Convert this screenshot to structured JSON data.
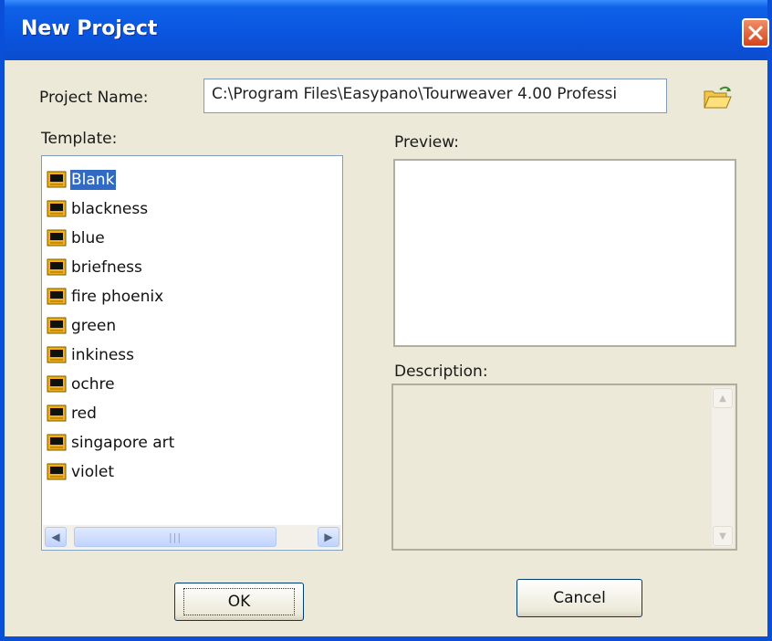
{
  "window": {
    "title": "New Project"
  },
  "project_name": {
    "label": "Project Name:",
    "value": "C:\\Program Files\\Easypano\\Tourweaver 4.00 Professi"
  },
  "template": {
    "label": "Template:",
    "items": [
      {
        "label": "Blank",
        "selected": true
      },
      {
        "label": "blackness"
      },
      {
        "label": "blue"
      },
      {
        "label": "briefness"
      },
      {
        "label": "fire phoenix"
      },
      {
        "label": "green"
      },
      {
        "label": "inkiness"
      },
      {
        "label": "ochre"
      },
      {
        "label": "red"
      },
      {
        "label": "singapore art"
      },
      {
        "label": "violet"
      }
    ]
  },
  "preview": {
    "label": "Preview:"
  },
  "description": {
    "label": "Description:"
  },
  "buttons": {
    "ok": "OK",
    "cancel": "Cancel"
  },
  "icons": {
    "close": "close-icon",
    "folder": "folder-open-icon",
    "template": "template-icon"
  },
  "colors": {
    "titlebar": "#0a55df",
    "selection": "#316ac5",
    "dialog_bg": "#ece9d8"
  }
}
